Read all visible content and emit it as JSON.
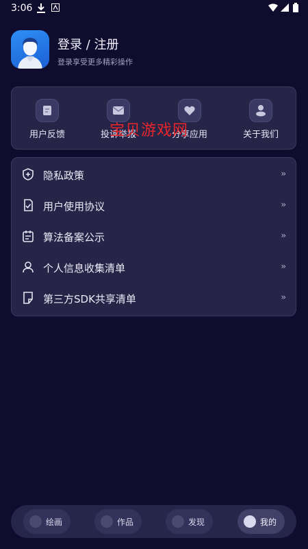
{
  "status_bar": {
    "time": "3:06"
  },
  "profile": {
    "title": "登录 / 注册",
    "subtitle": "登录享受更多精彩操作"
  },
  "quick_actions": [
    {
      "label": "用户反馈",
      "icon": "feedback-icon"
    },
    {
      "label": "投诉举报",
      "icon": "report-icon"
    },
    {
      "label": "分享应用",
      "icon": "share-icon"
    },
    {
      "label": "关于我们",
      "icon": "about-icon"
    }
  ],
  "menu": [
    {
      "label": "隐私政策",
      "icon": "privacy-shield-icon"
    },
    {
      "label": "用户使用协议",
      "icon": "agreement-icon"
    },
    {
      "label": "算法备案公示",
      "icon": "calendar-icon"
    },
    {
      "label": "个人信息收集清单",
      "icon": "person-icon"
    },
    {
      "label": "第三方SDK共享清单",
      "icon": "sdk-list-icon"
    }
  ],
  "watermark": "宝贝游戏网",
  "tabs": [
    {
      "label": "绘画",
      "active": false
    },
    {
      "label": "作品",
      "active": false
    },
    {
      "label": "发现",
      "active": false
    },
    {
      "label": "我的",
      "active": true
    }
  ],
  "colors": {
    "background": "#0f0c2e",
    "card": "#262548",
    "watermark": "#e8252b",
    "avatar": "#2f8ff5"
  }
}
